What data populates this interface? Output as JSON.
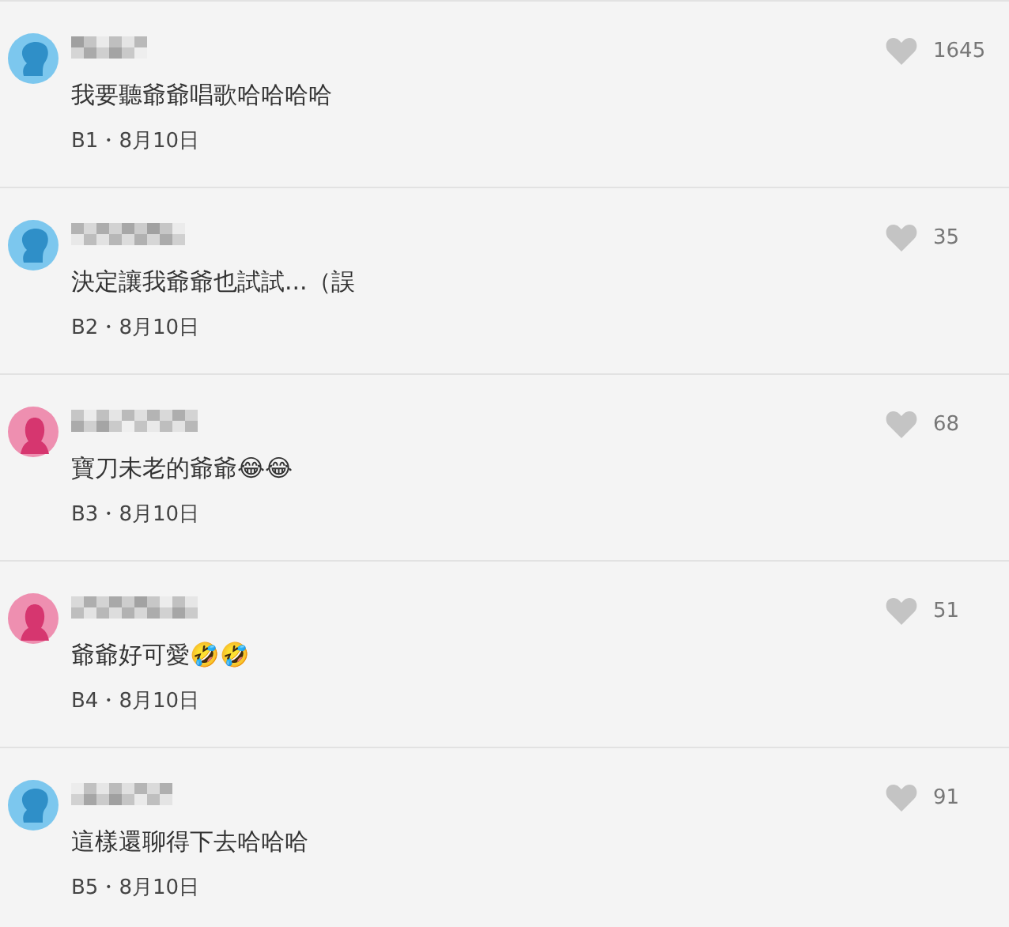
{
  "comments": [
    {
      "kind": "male",
      "text": "我要聽爺爺唱歌哈哈哈哈",
      "meta": "B1・8月10日",
      "likes": "1645"
    },
    {
      "kind": "male",
      "text": "決定讓我爺爺也試試...（誤",
      "meta": "B2・8月10日",
      "likes": "35"
    },
    {
      "kind": "female",
      "text": "寶刀未老的爺爺😂😂",
      "meta": "B3・8月10日",
      "likes": "68"
    },
    {
      "kind": "female",
      "text": "爺爺好可愛🤣🤣",
      "meta": "B4・8月10日",
      "likes": "51"
    },
    {
      "kind": "male",
      "text": "這樣還聊得下去哈哈哈",
      "meta": "B5・8月10日",
      "likes": "91"
    }
  ]
}
